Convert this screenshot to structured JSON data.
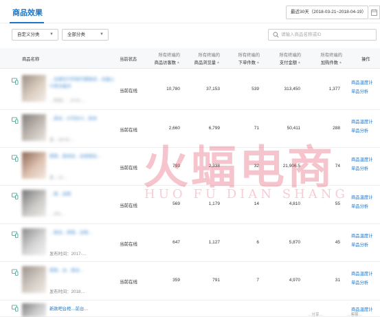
{
  "header": {
    "title": "商品效果",
    "date_range": "最近30天（2018-03-21~2018-04-19）"
  },
  "filters": {
    "category_custom": "自定义分类",
    "category_all": "全部分类",
    "search_placeholder": "请输入商品名称或ID"
  },
  "table": {
    "col_name": "商品名称",
    "col_status": "当前状态",
    "col_prefix": "所有终端的",
    "col_visitors": "商品访客数",
    "col_views": "商品浏览量",
    "col_orders": "下单件数",
    "col_amount": "支付金额",
    "col_cart": "加购件数",
    "col_action": "操作",
    "rows": [
      {
        "name": "…台建议行的现代服装店…台盒心沙发台盒台",
        "time": "…时间：…8-02-…",
        "status": "当前在线",
        "visitors": "10,780",
        "views": "37,153",
        "orders": "539",
        "amount": "313,450",
        "cart": "1,377",
        "op1": "商品温度计",
        "op2": "单品分析"
      },
      {
        "name": "…高台…公司办公…前台",
        "time": "发…18-02-…",
        "status": "当前在线",
        "visitors": "2,660",
        "views": "6,799",
        "orders": "71",
        "amount": "50,411",
        "cart": "288",
        "op1": "商品温度计",
        "op2": "单品分析"
      },
      {
        "name": "新款…接待台…台收银台…",
        "time": "发…12…",
        "status": "当前在线",
        "visitors": "793",
        "views": "2,338",
        "orders": "32",
        "amount": "21,906.5",
        "cart": "74",
        "op1": "商品温度计",
        "op2": "单品分析"
      },
      {
        "name": "…柜…店柜",
        "time": "…201…",
        "status": "当前在线",
        "visitors": "569",
        "views": "1,179",
        "orders": "14",
        "amount": "4,810",
        "cart": "55",
        "op1": "商品温度计",
        "op2": "单品分析"
      },
      {
        "name": "…柜台…转角…台柜…",
        "time": "发布时间：2017-…",
        "status": "当前在线",
        "visitors": "647",
        "views": "1,127",
        "orders": "6",
        "amount": "5,870",
        "cart": "45",
        "op1": "商品温度计",
        "op2": "单品分析"
      },
      {
        "name": "新款…台…柜台…",
        "time": "发布时间：2018…",
        "status": "当前在线",
        "visitors": "359",
        "views": "791",
        "orders": "7",
        "amount": "4,970",
        "cart": "31",
        "op1": "商品温度计",
        "op2": "单品分析"
      },
      {
        "name": "新款吧台柜…前台…",
        "time": "",
        "status": "",
        "visitors": "",
        "views": "",
        "orders": "",
        "amount": "",
        "cart": "",
        "op1": "商品温度计",
        "op2": ""
      }
    ]
  },
  "watermark": {
    "main": "火蝠电商",
    "sub": "HUO FU DIAN SHANG"
  },
  "footer": {
    "left": "…分享…",
    "right": "…客服…"
  },
  "colors": {
    "link": "#1a74c8",
    "watermark": "#e24864"
  }
}
